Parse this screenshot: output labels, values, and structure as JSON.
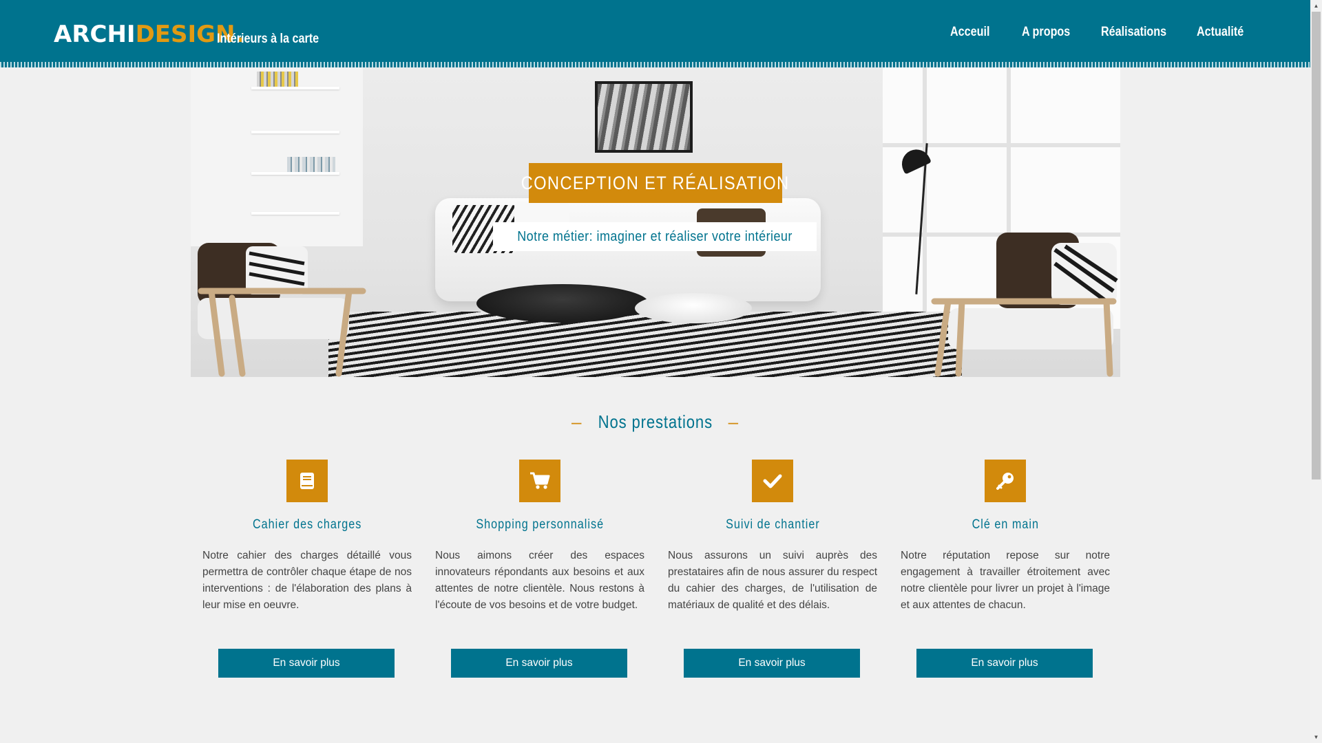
{
  "header": {
    "logo_archi": "ARCHI",
    "logo_design": "DESIGN",
    "logo_dot": ".",
    "tagline": "Intérieurs à la carte",
    "nav": [
      "Acceuil",
      "A propos",
      "Réalisations",
      "Actualité"
    ]
  },
  "hero": {
    "title": "CONCEPTION ET RÉALISATION",
    "subtitle": "Notre métier: imaginer et réaliser votre intérieur"
  },
  "services": {
    "title": "Nos prestations",
    "dash": "–",
    "cards": [
      {
        "icon": "book-icon",
        "title": "Cahier des charges",
        "text": "Notre cahier des charges détaillé vous permettra de contrôler chaque étape de nos interventions : de l'élaboration des plans à leur mise en oeuvre.",
        "button": "En savoir plus"
      },
      {
        "icon": "shopping-cart-icon",
        "title": "Shopping personnalisé",
        "text": "Nous aimons créer des espaces innovateurs répondants aux besoins et aux attentes de notre clientèle. Nous restons à l'écoute de vos besoins et de votre budget.",
        "button": "En savoir plus"
      },
      {
        "icon": "checkmark-icon",
        "title": "Suivi de chantier",
        "text": "Nous assurons un suivi auprès des prestataires afin de nous assurer du respect du cahier des charges, de l'utilisation de matériaux de qualité et des délais.",
        "button": "En savoir plus"
      },
      {
        "icon": "key-icon",
        "title": "Clé en main",
        "text": "Notre réputation repose sur notre engagement à travailler étroitement avec notre clientèle pour livrer un projet à l'image et aux attentes de chacun.",
        "button": "En savoir plus"
      }
    ]
  },
  "colors": {
    "primary": "#00738e",
    "accent": "#d28a0c",
    "background": "#f0f0f0"
  }
}
